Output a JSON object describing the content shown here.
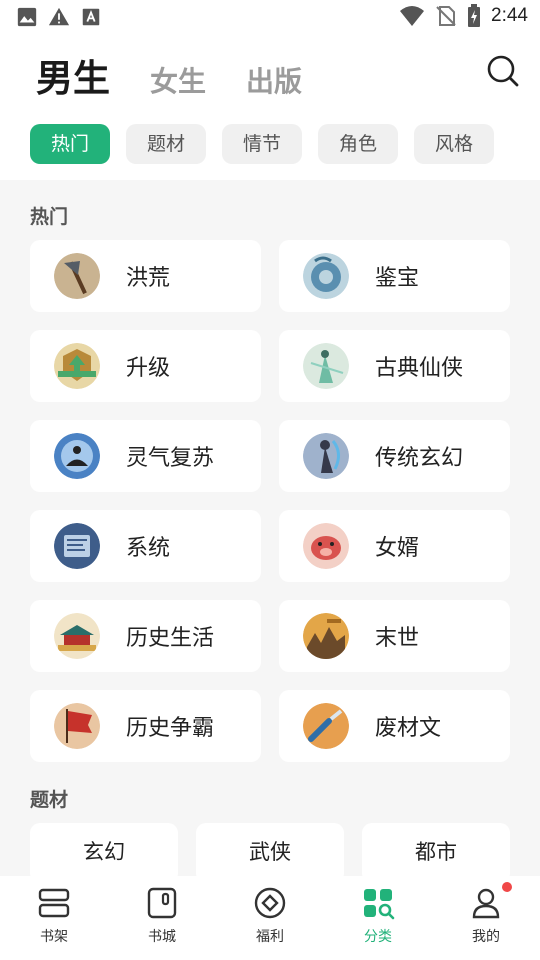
{
  "status_bar": {
    "time": "2:44"
  },
  "gender_tabs": [
    {
      "label": "男生",
      "active": true
    },
    {
      "label": "女生",
      "active": false
    },
    {
      "label": "出版",
      "active": false
    }
  ],
  "filter_chips": [
    {
      "label": "热门",
      "active": true
    },
    {
      "label": "题材",
      "active": false
    },
    {
      "label": "情节",
      "active": false
    },
    {
      "label": "角色",
      "active": false
    },
    {
      "label": "风格",
      "active": false
    }
  ],
  "hot_section": {
    "title": "热门",
    "items": [
      {
        "label": "洪荒",
        "icon": "axe-icon"
      },
      {
        "label": "鉴宝",
        "icon": "jade-disc-icon"
      },
      {
        "label": "升级",
        "icon": "level-up-badge-icon"
      },
      {
        "label": "古典仙侠",
        "icon": "immortal-swordsman-icon"
      },
      {
        "label": "灵气复苏",
        "icon": "meditation-icon"
      },
      {
        "label": "传统玄幻",
        "icon": "fantasy-warrior-icon"
      },
      {
        "label": "系统",
        "icon": "system-panel-icon"
      },
      {
        "label": "女婿",
        "icon": "pig-face-icon"
      },
      {
        "label": "历史生活",
        "icon": "palace-icon"
      },
      {
        "label": "末世",
        "icon": "ruined-city-icon"
      },
      {
        "label": "历史争霸",
        "icon": "war-flag-icon"
      },
      {
        "label": "废材文",
        "icon": "broken-sword-icon"
      }
    ]
  },
  "topic_section": {
    "title": "题材",
    "items": [
      "玄幻",
      "武侠",
      "都市"
    ]
  },
  "bottom_nav": [
    {
      "label": "书架",
      "icon": "bookshelf-icon",
      "active": false
    },
    {
      "label": "书城",
      "icon": "bookstore-icon",
      "active": false
    },
    {
      "label": "福利",
      "icon": "welfare-icon",
      "active": false
    },
    {
      "label": "分类",
      "icon": "category-icon",
      "active": true
    },
    {
      "label": "我的",
      "icon": "profile-icon",
      "active": false,
      "badge": true
    }
  ],
  "colors": {
    "accent": "#22b27a",
    "badge": "#f04848"
  }
}
